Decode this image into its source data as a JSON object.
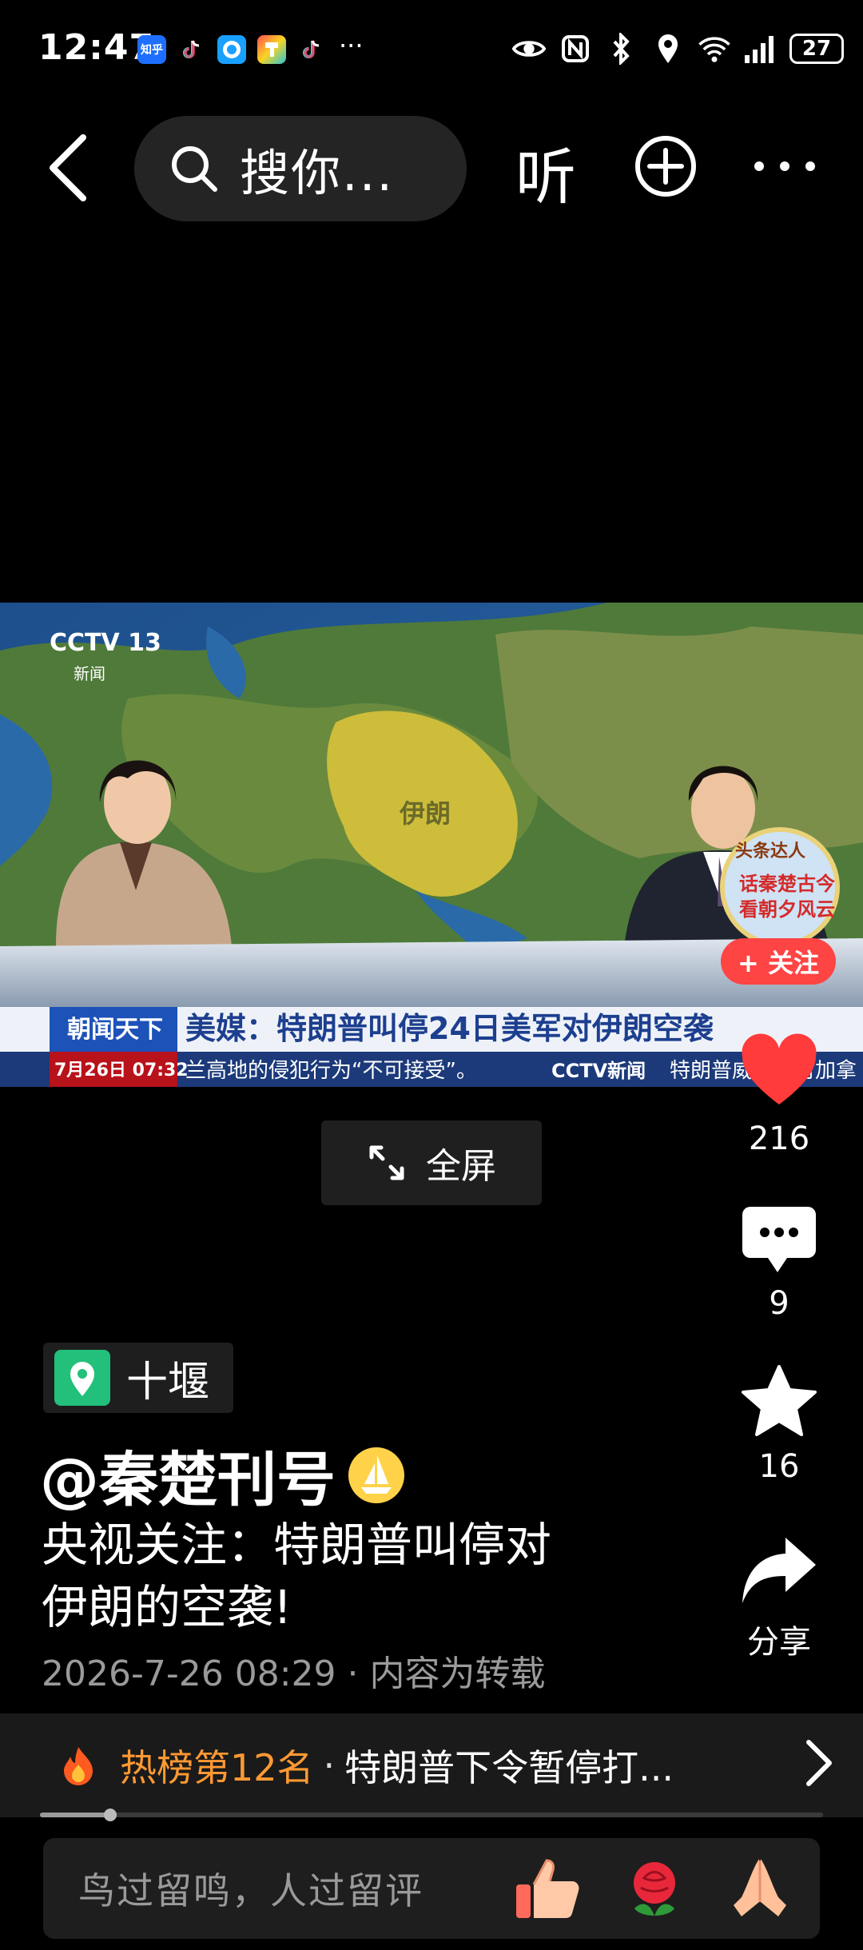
{
  "status_bar": {
    "time": "12:47",
    "app_icons": [
      "zhihu-icon",
      "tiktok-icon",
      "browser-icon",
      "painter-icon",
      "tiktok-icon"
    ],
    "app_zhihu_label": "知乎",
    "more": "···",
    "battery": "27"
  },
  "nav": {
    "search_placeholder": "搜你...",
    "listen_label": "听"
  },
  "video": {
    "channel_logo": "CCTV 13",
    "channel_sub": "新闻",
    "map_label": "伊朗",
    "program_name": "朝闻天下",
    "headline": "美媒：特朗普叫停24日美军对伊朗空袭",
    "date_time": "7月26日 07:32",
    "ticker": "兰高地的侵犯行为“不可接受”。",
    "ticker_logo": "CCTV新闻",
    "ticker_right": "特朗普威胁将对加拿",
    "badge_top": "头条达人",
    "badge_lines": [
      "话秦楚古今",
      "看朝夕风云"
    ],
    "follow_label": "+ 关注"
  },
  "fullscreen_label": "全屏",
  "actions": {
    "likes": "216",
    "comments": "9",
    "favorites": "16",
    "share_label": "分享"
  },
  "post": {
    "location": "十堰",
    "author": "@秦楚刊号",
    "title_line1": "央视关注：特朗普叫停对",
    "title_line2": "伊朗的空袭!",
    "meta": "2026-7-26 08:29 · 内容为转载"
  },
  "hot": {
    "rank": "热榜第12名",
    "dot": "·",
    "topic": "特朗普下令暂停打..."
  },
  "progress": 0.09,
  "comment_bar": {
    "placeholder": "鸟过留鸣，人过留评",
    "emojis": [
      "thumbs-up-icon",
      "rose-icon",
      "praying-hands-icon"
    ]
  },
  "colors": {
    "like_red": "#ff3b3b",
    "hot_orange": "#ff9933",
    "follow_red": "#ff4444"
  }
}
